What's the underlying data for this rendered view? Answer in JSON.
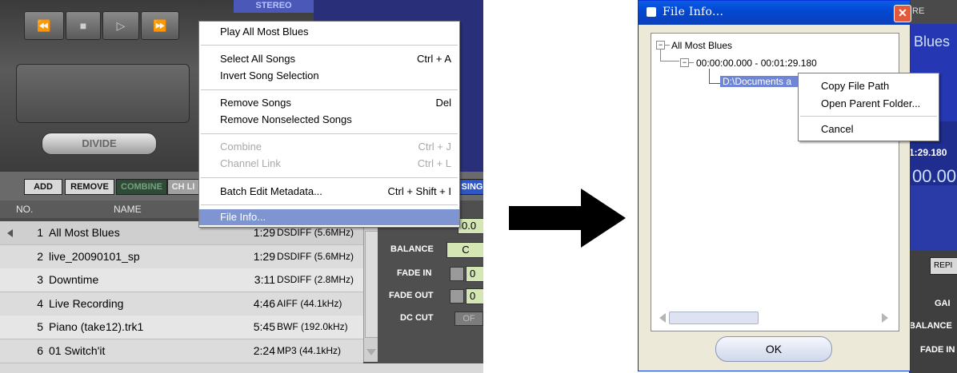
{
  "player": {
    "stereo_label": "STEREO",
    "transport": [
      "⏪",
      "■",
      "▷",
      "⏩"
    ],
    "divide_label": "DIVIDE",
    "toolbar": {
      "add": "ADD",
      "remove": "REMOVE",
      "combine": "COMBINE",
      "chlink": "CH LI",
      "single": "SING"
    },
    "columns": {
      "no": "NO.",
      "name": "NAME"
    },
    "rows": [
      {
        "no": "1",
        "name": "All Most Blues",
        "time": "1:29",
        "format": "DSDIFF (5.6MHz)"
      },
      {
        "no": "2",
        "name": "live_20090101_sp",
        "time": "1:29",
        "format": "DSDIFF (5.6MHz)"
      },
      {
        "no": "3",
        "name": "Downtime",
        "time": "3:11",
        "format": "DSDIFF (2.8MHz)"
      },
      {
        "no": "4",
        "name": "Live Recording",
        "time": "4:46",
        "format": "AIFF (44.1kHz)"
      },
      {
        "no": "5",
        "name": "Piano (take12).trk1",
        "time": "5:45",
        "format": "BWF (192.0kHz)"
      },
      {
        "no": "6",
        "name": "01 Switch'it",
        "time": "2:24",
        "format": "MP3 (44.1kHz)"
      }
    ],
    "mixer": {
      "top_value": "0.0",
      "balance_label": "BALANCE",
      "balance_value": "C",
      "fadein_label": "FADE IN",
      "fadein_value": "0",
      "fadeout_label": "FADE OUT",
      "fadeout_value": "0",
      "dccut_label": "DC CUT",
      "dccut_value": "OF"
    }
  },
  "context_menu": {
    "items": [
      {
        "label": "Play All Most Blues",
        "shortcut": ""
      },
      {
        "label": "Select All Songs",
        "shortcut": "Ctrl + A"
      },
      {
        "label": "Invert Song Selection",
        "shortcut": ""
      },
      {
        "label": "Remove Songs",
        "shortcut": "Del"
      },
      {
        "label": "Remove Nonselected Songs",
        "shortcut": ""
      },
      {
        "label": "Combine",
        "shortcut": "Ctrl + J"
      },
      {
        "label": "Channel Link",
        "shortcut": "Ctrl + L"
      },
      {
        "label": "Batch Edit Metadata...",
        "shortcut": "Ctrl + Shift + I"
      },
      {
        "label": "File Info...",
        "shortcut": ""
      }
    ]
  },
  "dialog": {
    "title": "File Info...",
    "close": "✕",
    "tree": {
      "root": "All Most Blues",
      "range": "00:00:00.000 - 00:01:29.180",
      "path": "D:\\Documents a"
    },
    "ok_label": "OK"
  },
  "file_context_menu": {
    "items": [
      "Copy File Path",
      "Open Parent Folder...",
      "Cancel"
    ]
  },
  "background_player": {
    "re": "RE",
    "blues": "Blues",
    "time1": "1:29.180",
    "time2": "00.00",
    "rep": "REPI",
    "gain": "GAI",
    "balance": "BALANCE",
    "fadein": "FADE IN"
  },
  "colors": {
    "menu_highlight": "#7e95d1",
    "dialog_title": "#0348d3",
    "lcd": "#d4e6b4"
  }
}
